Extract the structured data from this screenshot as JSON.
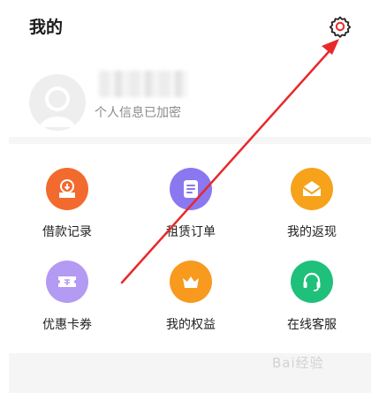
{
  "header": {
    "title": "我的",
    "settings_icon": "gear-icon"
  },
  "profile": {
    "avatar_icon": "default-avatar-icon",
    "note": "个人信息已加密"
  },
  "grid": {
    "items": [
      {
        "label": "借款记录",
        "icon": "download-tray-icon",
        "color": "#f26a2e"
      },
      {
        "label": "租赁订单",
        "icon": "document-icon",
        "color": "#8a78f0"
      },
      {
        "label": "我的返现",
        "icon": "envelope-heart-icon",
        "color": "#f6a21a"
      },
      {
        "label": "优惠卡券",
        "icon": "coupon-icon",
        "color": "#b39af3"
      },
      {
        "label": "我的权益",
        "icon": "crown-icon",
        "color": "#f79a1e"
      },
      {
        "label": "在线客服",
        "icon": "headset-icon",
        "color": "#1fc07a"
      }
    ]
  },
  "annotation": {
    "arrow_color": "#e8292b"
  },
  "watermark": {
    "text": "Bai经验"
  }
}
